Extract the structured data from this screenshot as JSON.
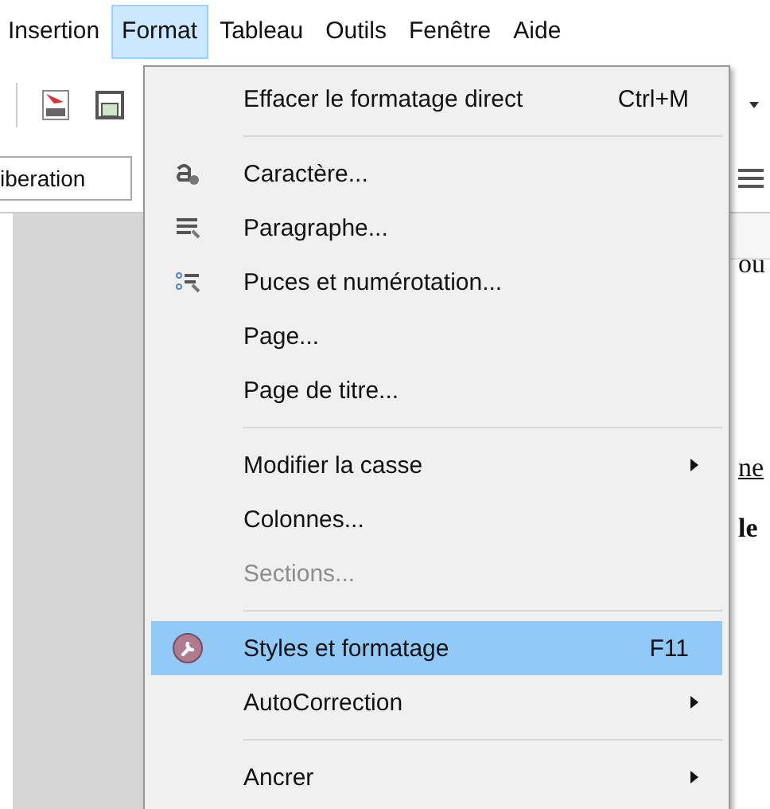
{
  "menubar": [
    {
      "label": "Insertion",
      "selected": false
    },
    {
      "label": "Format",
      "selected": true
    },
    {
      "label": "Tableau",
      "selected": false
    },
    {
      "label": "Outils",
      "selected": false
    },
    {
      "label": "Fenêtre",
      "selected": false
    },
    {
      "label": "Aide",
      "selected": false
    }
  ],
  "font_box": {
    "value": "iberation"
  },
  "document_fragments": [
    {
      "text": "ou",
      "kind": "plain"
    },
    {
      "text": "ne",
      "kind": "underlined"
    },
    {
      "text": "le",
      "kind": "bold"
    }
  ],
  "format_menu": [
    {
      "kind": "item",
      "label": "Effacer le formatage direct",
      "shortcut": "Ctrl+M",
      "submenu": false,
      "disabled": false,
      "selected": false
    },
    {
      "kind": "separator"
    },
    {
      "kind": "item",
      "label": "Caractère...",
      "submenu": false,
      "disabled": false,
      "selected": false
    },
    {
      "kind": "item",
      "label": "Paragraphe...",
      "submenu": false,
      "disabled": false,
      "selected": false
    },
    {
      "kind": "item",
      "label": "Puces et numérotation...",
      "submenu": false,
      "disabled": false,
      "selected": false
    },
    {
      "kind": "item",
      "label": "Page...",
      "submenu": false,
      "disabled": false,
      "selected": false
    },
    {
      "kind": "item",
      "label": "Page de titre...",
      "submenu": false,
      "disabled": false,
      "selected": false
    },
    {
      "kind": "separator"
    },
    {
      "kind": "item",
      "label": "Modifier la casse",
      "submenu": true,
      "disabled": false,
      "selected": false
    },
    {
      "kind": "item",
      "label": "Colonnes...",
      "submenu": false,
      "disabled": false,
      "selected": false
    },
    {
      "kind": "item",
      "label": "Sections...",
      "submenu": false,
      "disabled": true,
      "selected": false
    },
    {
      "kind": "separator"
    },
    {
      "kind": "item",
      "label": "Styles et formatage",
      "shortcut": "F11",
      "submenu": false,
      "disabled": false,
      "selected": true
    },
    {
      "kind": "item",
      "label": "AutoCorrection",
      "submenu": true,
      "disabled": false,
      "selected": false
    },
    {
      "kind": "separator"
    },
    {
      "kind": "item",
      "label": "Ancrer",
      "submenu": true,
      "disabled": false,
      "selected": false
    }
  ]
}
